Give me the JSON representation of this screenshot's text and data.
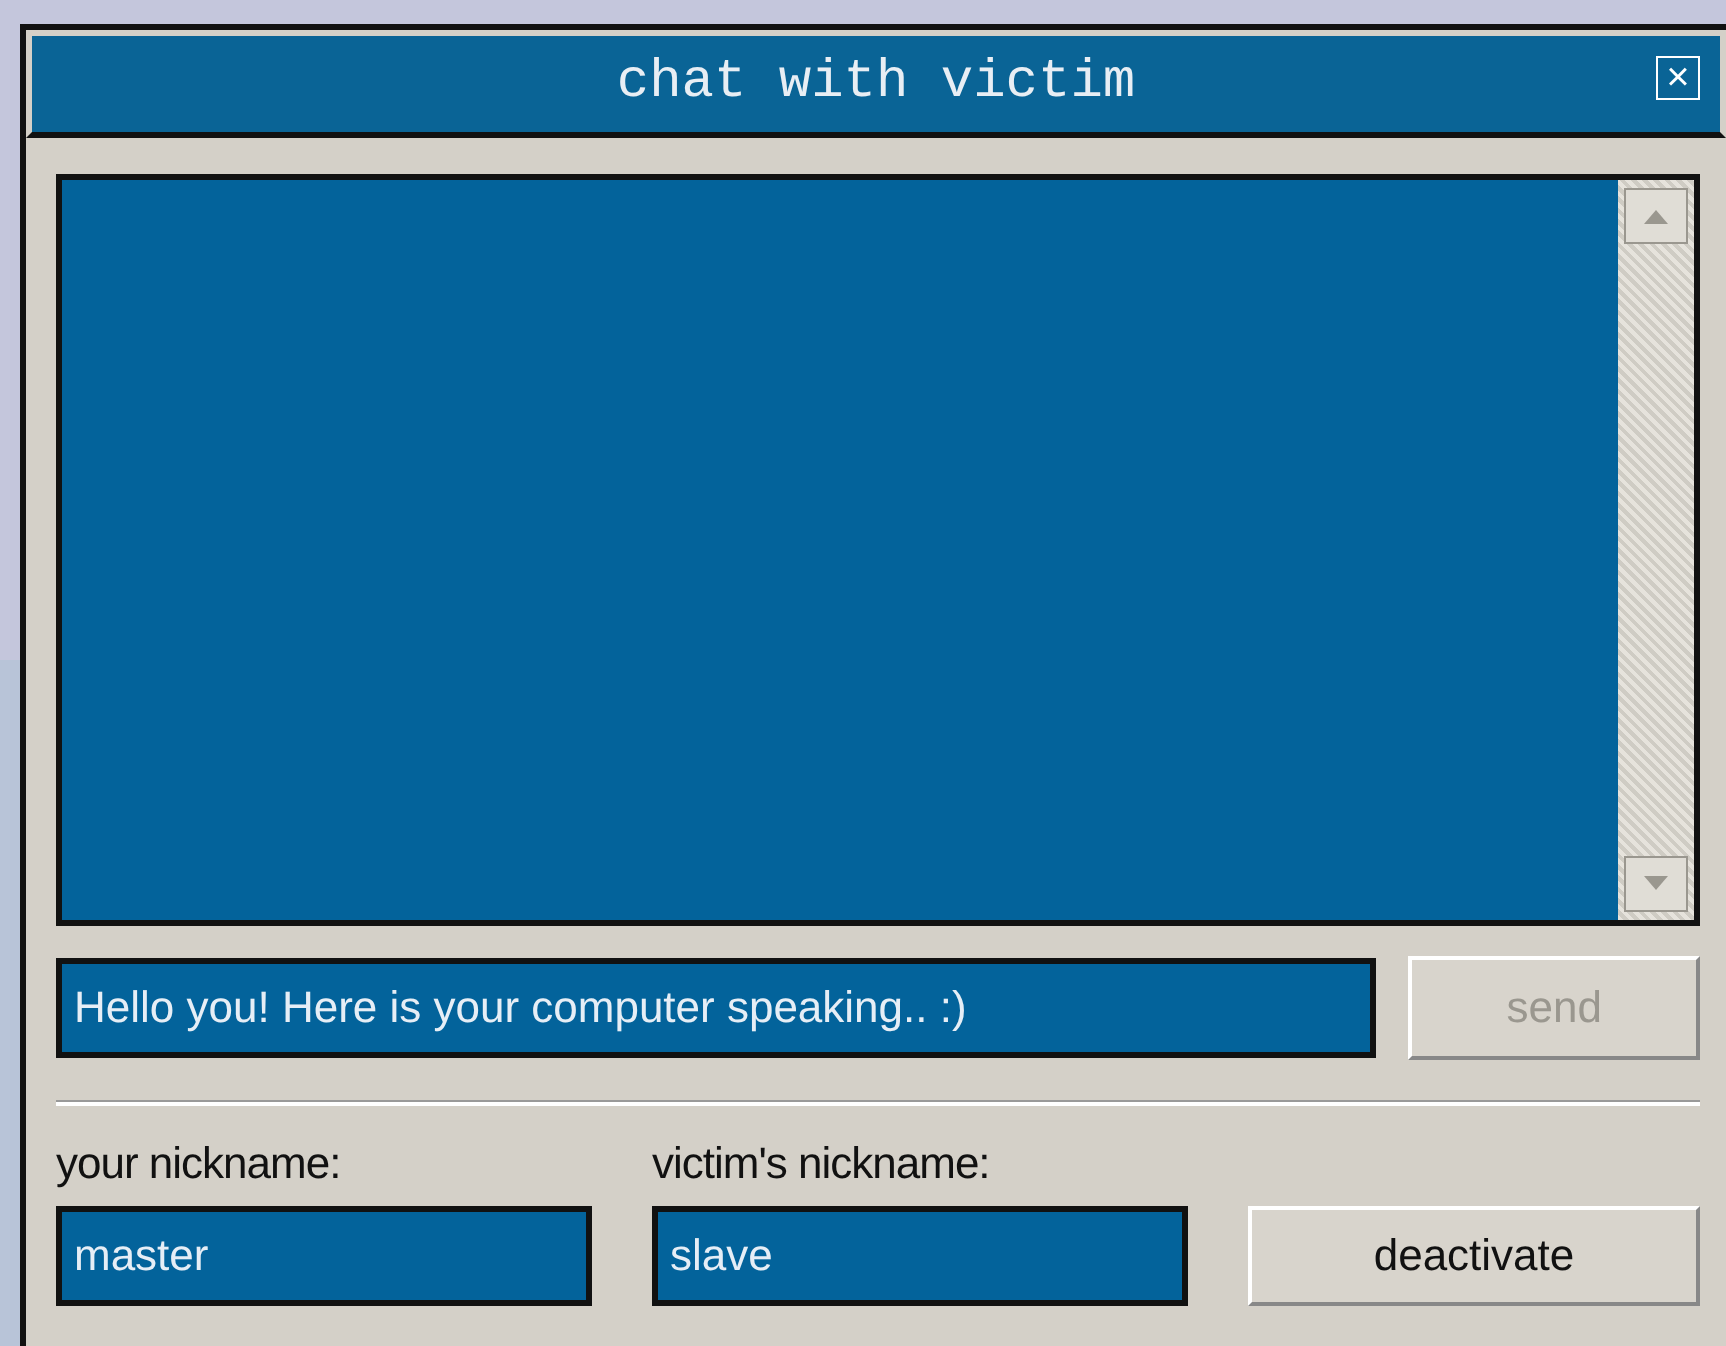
{
  "window": {
    "title": "chat with victim",
    "close_glyph": "×"
  },
  "message_input": {
    "value": "Hello you! Here is your computer speaking.. :)"
  },
  "send_button": {
    "label": "send",
    "disabled": true
  },
  "your_nickname": {
    "label": "your nickname:",
    "value": "master"
  },
  "victim_nickname": {
    "label": "victim's nickname:",
    "value": "slave"
  },
  "deactivate_button": {
    "label": "deactivate",
    "disabled": false
  }
}
